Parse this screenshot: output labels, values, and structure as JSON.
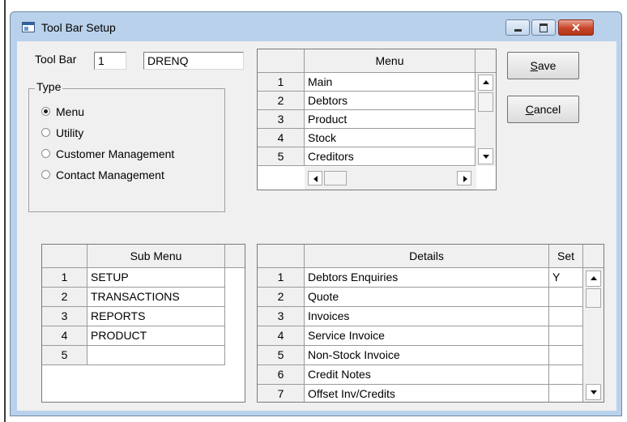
{
  "window": {
    "title": "Tool Bar Setup",
    "close_glyph": "✕"
  },
  "toolbar": {
    "label": "Tool Bar",
    "number": "1",
    "code": "DRENQ"
  },
  "type_group": {
    "title": "Type",
    "options": [
      "Menu",
      "Utility",
      "Customer Management",
      "Contact Management"
    ],
    "selected": "Menu"
  },
  "buttons": {
    "save_accel": "S",
    "save_rest": "ave",
    "cancel_accel": "C",
    "cancel_rest": "ancel"
  },
  "menu_grid": {
    "header": "Menu",
    "rows": [
      {
        "no": "1",
        "name": "Main"
      },
      {
        "no": "2",
        "name": "Debtors"
      },
      {
        "no": "3",
        "name": "Product"
      },
      {
        "no": "4",
        "name": "Stock"
      },
      {
        "no": "5",
        "name": "Creditors"
      }
    ]
  },
  "submenu_grid": {
    "header": "Sub Menu",
    "rows": [
      {
        "no": "1",
        "name": "SETUP"
      },
      {
        "no": "2",
        "name": "TRANSACTIONS"
      },
      {
        "no": "3",
        "name": "REPORTS"
      },
      {
        "no": "4",
        "name": "PRODUCT"
      },
      {
        "no": "5",
        "name": ""
      }
    ]
  },
  "details_grid": {
    "header": "Details",
    "set_header": "Set",
    "rows": [
      {
        "no": "1",
        "name": "Debtors Enquiries",
        "set": "Y"
      },
      {
        "no": "2",
        "name": "Quote",
        "set": ""
      },
      {
        "no": "3",
        "name": "Invoices",
        "set": ""
      },
      {
        "no": "4",
        "name": "Service Invoice",
        "set": ""
      },
      {
        "no": "5",
        "name": "Non-Stock Invoice",
        "set": ""
      },
      {
        "no": "6",
        "name": "Credit Notes",
        "set": ""
      },
      {
        "no": "7",
        "name": "Offset Inv/Credits",
        "set": ""
      }
    ]
  }
}
